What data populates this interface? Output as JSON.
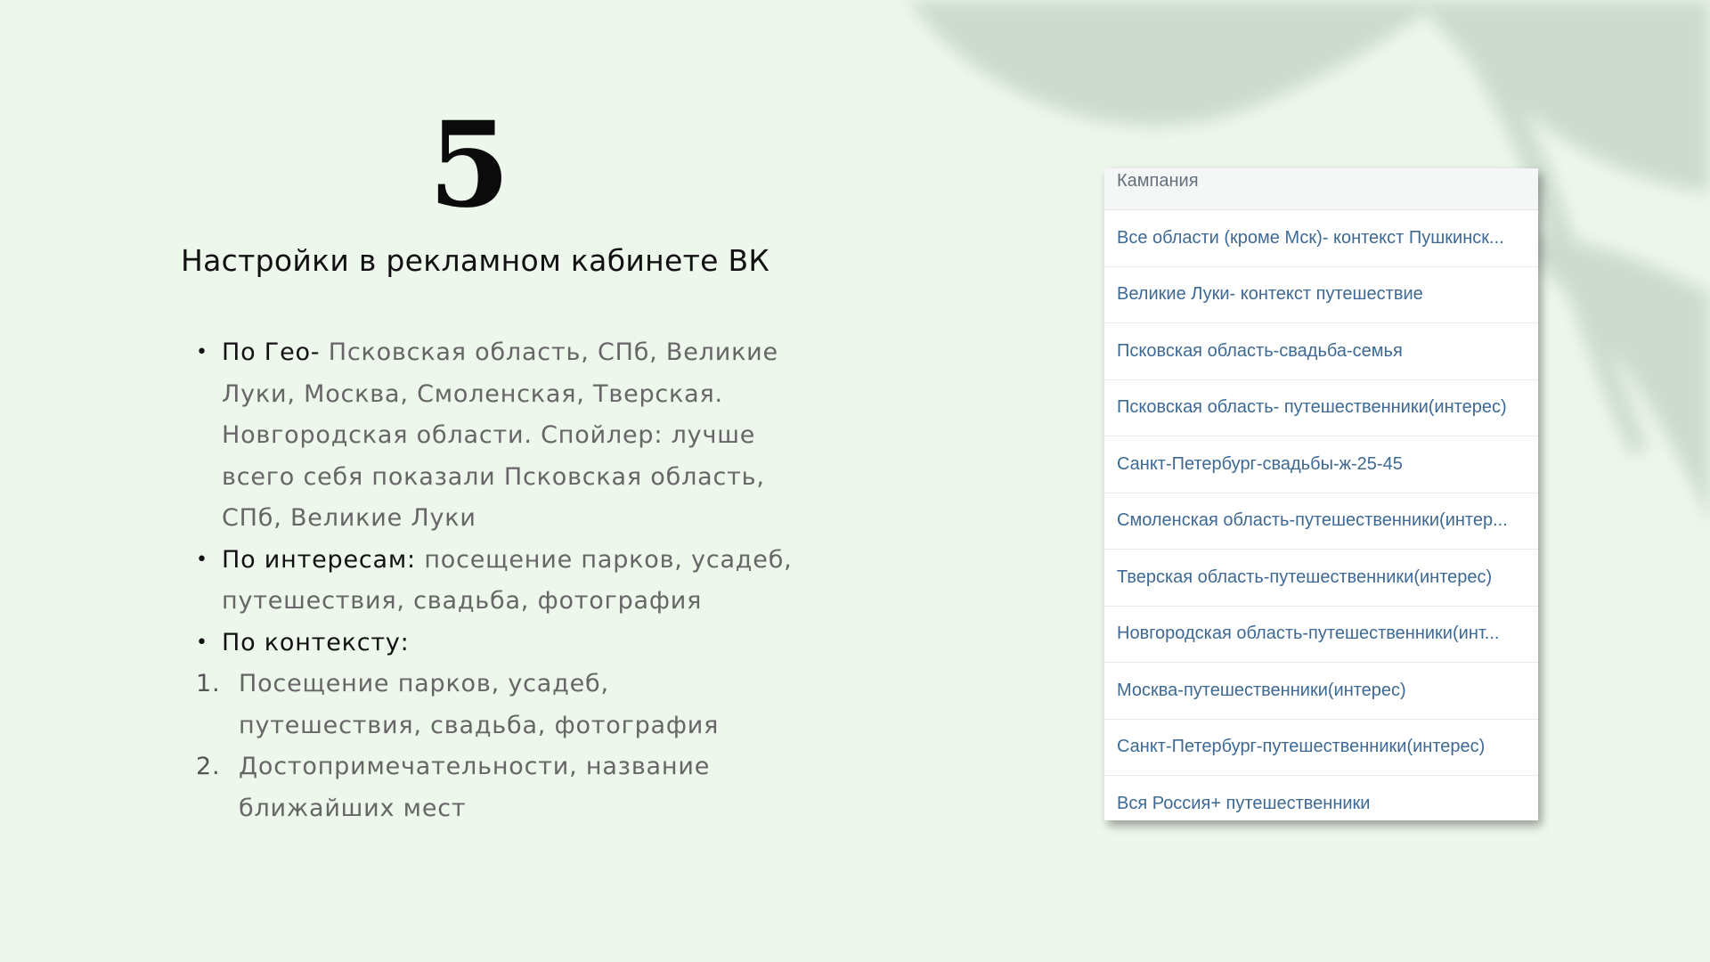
{
  "slide": {
    "number": "5",
    "title": "Настройки в рекламном кабинете ВК",
    "items": [
      {
        "marker": "•",
        "type": "bullet",
        "lead": "По Гео-",
        "text": " Псковская область, СПб, Великие Луки, Москва, Смоленская, Тверская. Новгородская области. Спойлер: лучше всего себя показали Псковская область, СПб, Великие Луки"
      },
      {
        "marker": "•",
        "type": "bullet",
        "lead": "По интересам:",
        "text": " посещение парков, усадеб, путешествия, свадьба, фотография"
      },
      {
        "marker": "•",
        "type": "bullet",
        "lead": "По контексту:",
        "text": ""
      },
      {
        "marker": "1.",
        "type": "number",
        "lead": "",
        "text": "Посещение парков, усадеб, путешествия, свадьба, фотография"
      },
      {
        "marker": "2.",
        "type": "number",
        "lead": "",
        "text": "Достопримечательности, название ближайших мест"
      }
    ]
  },
  "campaign_table": {
    "header": "Кампания",
    "rows": [
      "Все области (кроме Мск)- контекст Пушкинск...",
      "Великие Луки- контекст путешествие",
      "Псковская область-свадьба-семья",
      "Псковская область- путешественники(интерес)",
      "Санкт-Петербург-свадьбы-ж-25-45",
      "Смоленская область-путешественники(интер...",
      "Тверская область-путешественники(интерес)",
      "Новгородская область-путешественники(инт...",
      "Москва-путешественники(интерес)",
      "Санкт-Петербург-путешественники(интерес)",
      "Вся Россия+ путешественники"
    ]
  },
  "colors": {
    "background": "#edf7eb",
    "leaf_shadow": "#c8d6cb",
    "link": "#3d6994",
    "header_text": "#65707c",
    "body_text": "#666666",
    "title_text": "#111111"
  }
}
